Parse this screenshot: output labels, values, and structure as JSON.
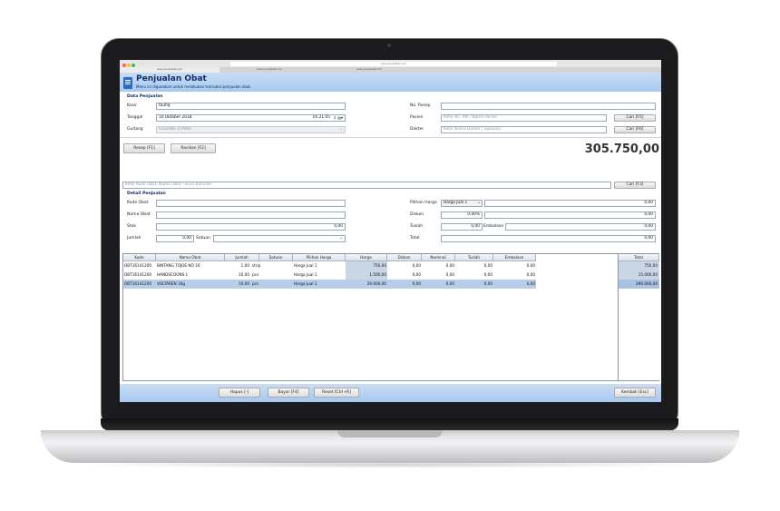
{
  "browser": {
    "url": "www.yourwebsite.com",
    "tabs": [
      "www.yourwebsite.com",
      "www.yourwebsite.com",
      "www.yourwebsite.com"
    ]
  },
  "header": {
    "title": "Penjualan Obat",
    "subtitle": "Menu ini digunakan untuk melakukan transaksi penjualan obat."
  },
  "data_penjualan": {
    "section_label": "Data Penjualan",
    "kasir_label": "Kasir",
    "kasir_value": "taufiq",
    "tanggal_label": "Tanggal",
    "tanggal_value": "10  Oktober  2018",
    "time_value": "05.21.05",
    "gudang_label": "Gudang",
    "gudang_value": "GUDANG UTAMA",
    "resep_label": "No. Resep",
    "resep_value": "",
    "pasien_label": "Pasien",
    "pasien_placeholder": "Ketik No. RM / Nama Pasien",
    "dokter_label": "Dokter",
    "dokter_placeholder": "Ketik Nama Dokter / Spesialis",
    "cari_pasien": "Cari [F5]",
    "cari_dokter": "Cari [F6]"
  },
  "actions": {
    "resep": "Resep [F1]",
    "racikan": "Racikan [F2]"
  },
  "grand_total": "305.750,00",
  "search": {
    "placeholder": "Ketik Kode Obat, Nama Obat / Scan Barcode",
    "button": "Cari [F3]"
  },
  "detail": {
    "section_label": "Detail Penjualan",
    "kode_label": "Kode Obat",
    "nama_label": "Nama Obat",
    "stok_label": "Stok",
    "stok_value": "0,00",
    "jumlah_label": "Jumlah",
    "jumlah_value": "0,00",
    "satuan_label": "Satuan",
    "pilihan_label": "Pilihan Harga",
    "pilihan_value": "Harga Jual 1",
    "harga_value": "0,00",
    "diskon_label": "Diskon",
    "diskon_pct": "0,00%",
    "diskon_value": "0,00",
    "tuslah_label": "Tuslah",
    "tuslah_value": "0,00",
    "embalase_label": "Embalase",
    "embalase_value": "0,00",
    "total_label": "Total",
    "total_value": "0,00"
  },
  "table": {
    "headers": [
      "Kode",
      "Nama Obat",
      "Jumlah",
      "Satuan",
      "Pilihan Harga",
      "Harga",
      "Diskon",
      "Nominal",
      "Tuslah",
      "Embalase"
    ],
    "total_header": "Total",
    "rows": [
      {
        "kode": "OBT16141200",
        "nama": "BINTANG TOJOE NO 16",
        "jumlah": "1,00",
        "satuan": "strip",
        "pilihan": "Harga Jual 1",
        "harga": "750,00",
        "diskon": "0,00",
        "nominal": "0,00",
        "tuslah": "0,00",
        "embalase": "0,00",
        "total": "750,00"
      },
      {
        "kode": "OBT16141200",
        "nama": "HANDSCOONS L",
        "jumlah": "10,00",
        "satuan": "pcs",
        "pilihan": "Harga Jual 1",
        "harga": "1.500,00",
        "diskon": "0,00",
        "nominal": "0,00",
        "tuslah": "0,00",
        "embalase": "0,00",
        "total": "15.000,00"
      },
      {
        "kode": "OBT16141200",
        "nama": "VOLTAREN 10g",
        "jumlah": "10,00",
        "satuan": "pcs",
        "pilihan": "Harga Jual 1",
        "harga": "29.000,00",
        "diskon": "0,00",
        "nominal": "0,00",
        "tuslah": "0,00",
        "embalase": "0,00",
        "total": "290.000,00"
      }
    ]
  },
  "footer": {
    "hapus": "Hapus [-]",
    "bayar": "Bayar [F4]",
    "reset": "Reset [Ctrl+R]",
    "kembali": "Kembali [Esc]"
  },
  "colors": {
    "header_bg": "#b5d0f1",
    "accent": "#0d2f66",
    "row_selected": "#b8cde8"
  }
}
